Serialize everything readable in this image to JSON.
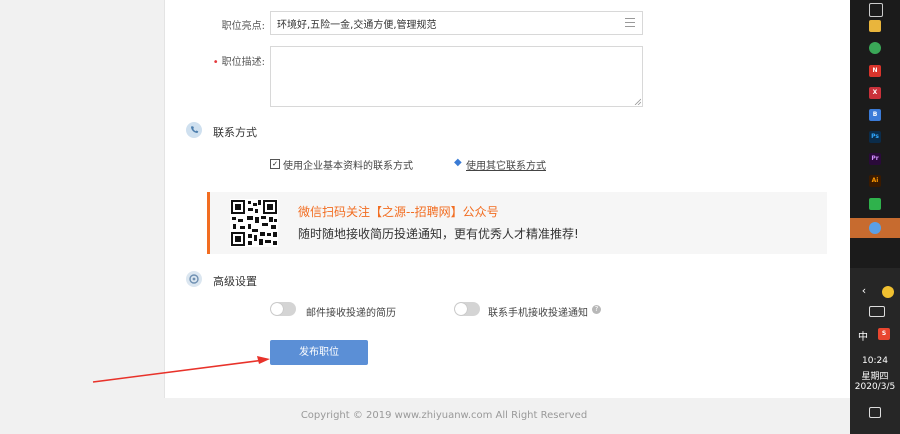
{
  "form": {
    "highlights_label": "职位亮点:",
    "highlights_value": "环境好,五险一金,交通方便,管理规范",
    "description_required_mark": "•",
    "description_label": "职位描述:",
    "description_value": ""
  },
  "contact": {
    "section_title": "联系方式",
    "use_company_contact_label": "使用企业基本资料的联系方式",
    "use_company_contact_checked": true,
    "other_contact_link": "使用其它联系方式"
  },
  "wechat": {
    "title": "微信扫码关注【之源--招聘网】公众号",
    "subtitle": "随时随地接收简历投递通知，更有优秀人才精准推荐!"
  },
  "advanced": {
    "section_title": "高级设置",
    "email_toggle_label": "邮件接收投递的简历",
    "email_toggle_on": false,
    "sms_toggle_label": "联系手机接收投递通知",
    "sms_toggle_on": false
  },
  "publish_button_label": "发布职位",
  "footer": "Copyright © 2019 www.zhiyuanw.com All Right Reserved",
  "colors": {
    "accent_orange": "#f26d21",
    "button_blue": "#5b8fd6",
    "required_red": "#e4393c",
    "annotation_arrow": "#e8322a"
  },
  "taskbar": {
    "input_method": "中",
    "ime_badge": "S",
    "time": "10:24",
    "weekday": "星期四",
    "date": "2020/3/5"
  }
}
